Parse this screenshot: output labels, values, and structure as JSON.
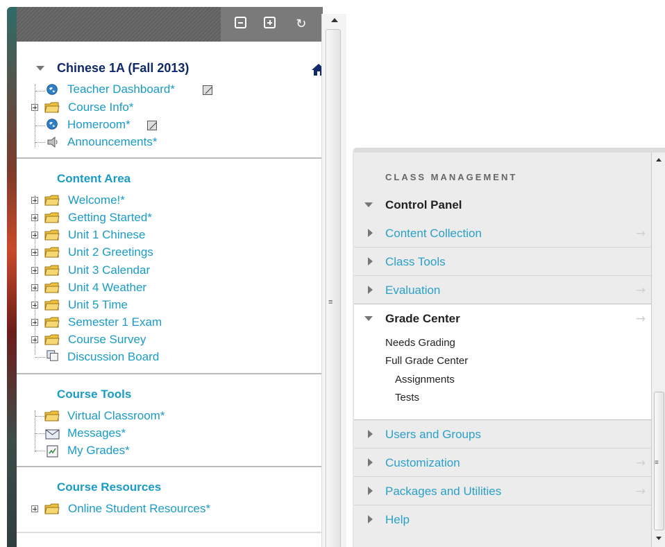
{
  "left_panel": {
    "toolbar": {
      "collapse_label": "−",
      "expand_label": "+",
      "refresh_label": "↻"
    },
    "course": {
      "title": "Chinese 1A (Fall 2013)",
      "items": [
        {
          "label": "Teacher Dashboard*",
          "icon": "globe-icon",
          "editable": true
        },
        {
          "label": "Course Info*",
          "icon": "folder-icon",
          "expandable": true
        },
        {
          "label": "Homeroom*",
          "icon": "globe-icon",
          "editable": true
        },
        {
          "label": "Announcements*",
          "icon": "speaker-icon"
        }
      ]
    },
    "content_area": {
      "heading": "Content Area",
      "items": [
        {
          "label": "Welcome!*"
        },
        {
          "label": "Getting Started*"
        },
        {
          "label": "Unit 1 Chinese"
        },
        {
          "label": "Unit 2 Greetings"
        },
        {
          "label": "Unit 3 Calendar"
        },
        {
          "label": "Unit 4 Weather"
        },
        {
          "label": "Unit 5 Time"
        },
        {
          "label": "Semester 1 Exam"
        },
        {
          "label": "Course Survey"
        },
        {
          "label": "Discussion Board"
        }
      ]
    },
    "course_tools": {
      "heading": "Course Tools",
      "items": [
        {
          "label": "Virtual Classroom*"
        },
        {
          "label": "Messages*"
        },
        {
          "label": "My Grades*"
        }
      ]
    },
    "course_resources": {
      "heading": "Course Resources",
      "items": [
        {
          "label": "Online Student Resources*"
        }
      ]
    }
  },
  "right_panel": {
    "heading": "CLASS MANAGEMENT",
    "control_panel": "Control Panel",
    "items_top": [
      {
        "label": "Content Collection",
        "arrow": "→"
      },
      {
        "label": "Class Tools",
        "arrow": ""
      },
      {
        "label": "Evaluation",
        "arrow": "→"
      }
    ],
    "grade_center": {
      "label": "Grade Center",
      "arrow": "→",
      "sub": [
        "Needs Grading",
        "Full Grade Center",
        "Assignments",
        "Tests"
      ]
    },
    "items_bottom": [
      {
        "label": "Users and Groups",
        "arrow": ""
      },
      {
        "label": "Customization",
        "arrow": "→"
      },
      {
        "label": "Packages and Utilities",
        "arrow": "→"
      },
      {
        "label": "Help",
        "arrow": ""
      }
    ]
  },
  "colors": {
    "link": "#1a9bc6",
    "title": "#10296a",
    "toolbar": "#6b6b6b"
  }
}
